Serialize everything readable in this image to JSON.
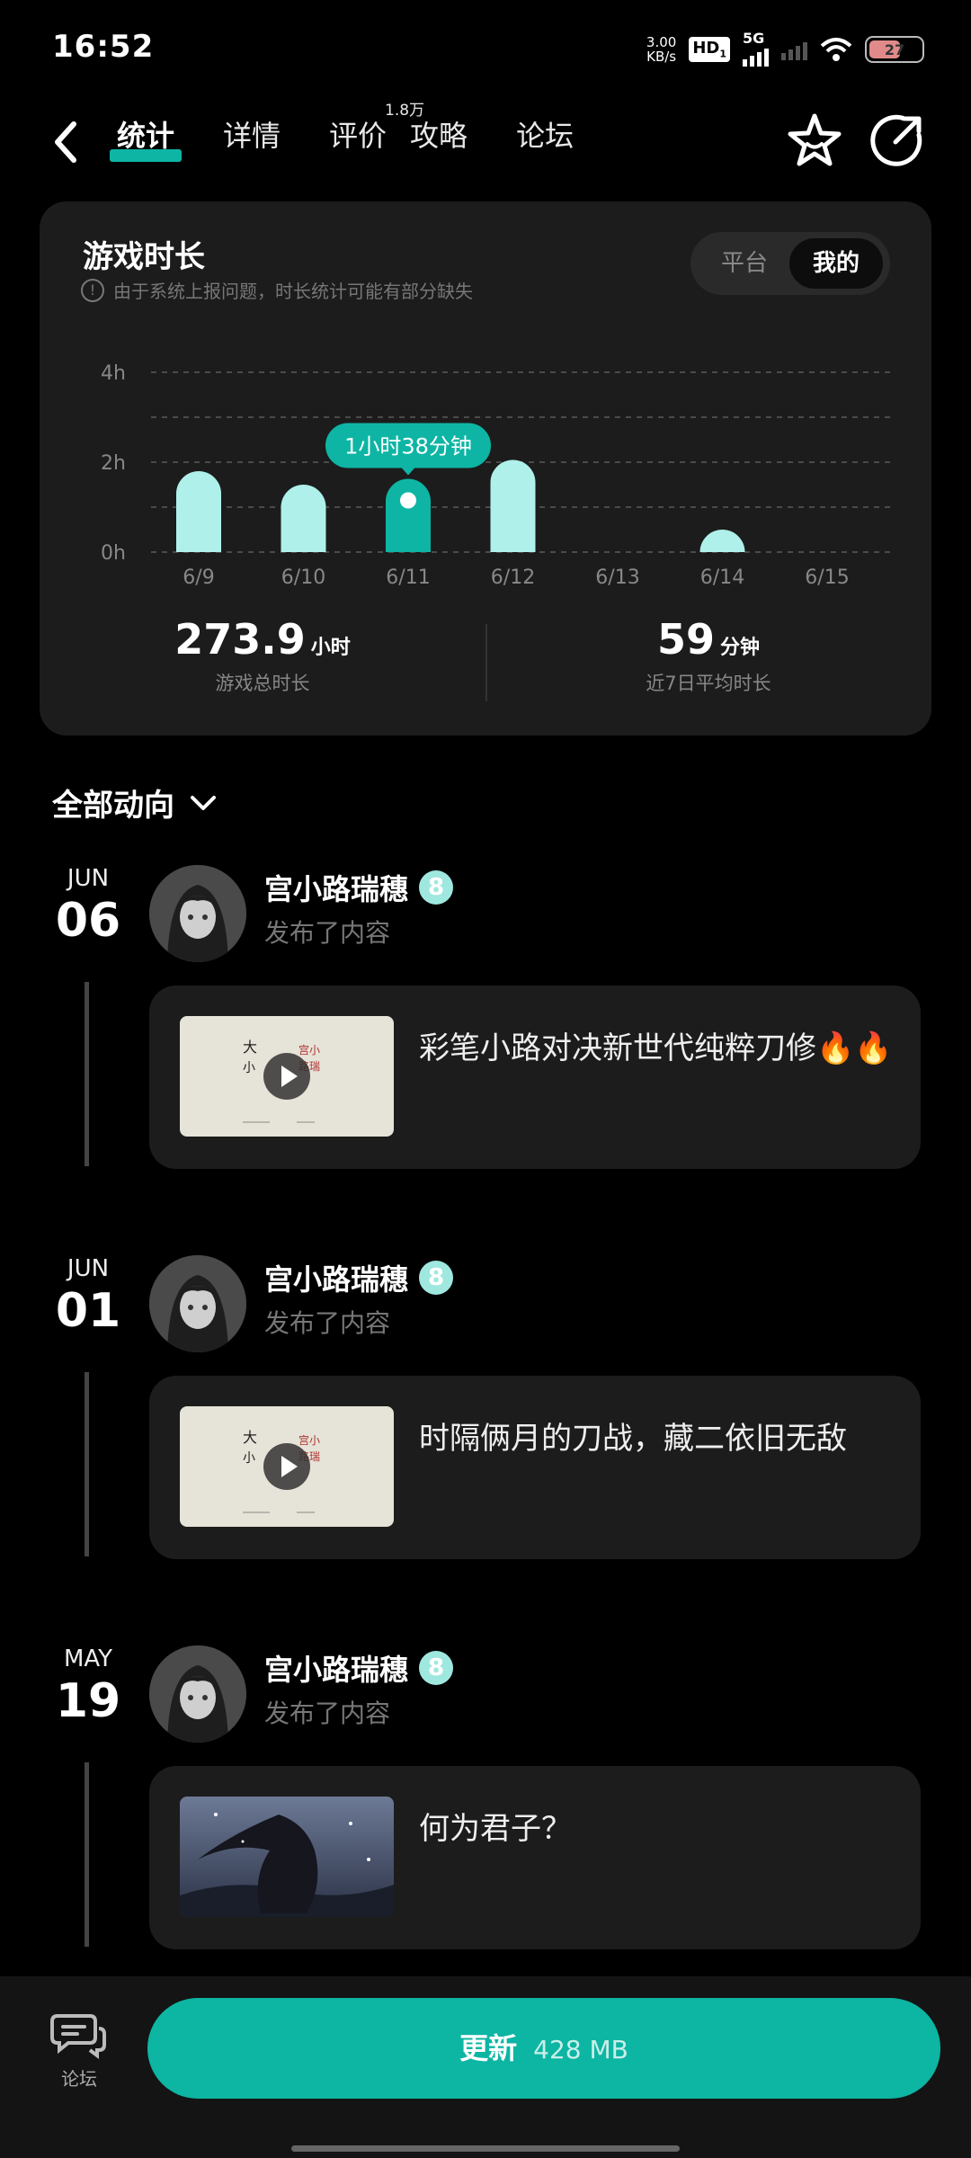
{
  "status_bar": {
    "time": "16:52",
    "net_speed": "3.00",
    "net_unit": "KB/s",
    "hd": "HD",
    "hd_sub": "1",
    "signal_type": "5G",
    "battery": "27"
  },
  "nav": {
    "tabs": [
      "统计",
      "详情",
      "评价",
      "攻略",
      "论坛"
    ],
    "review_count": "1.8万"
  },
  "stats_card": {
    "title": "游戏时长",
    "note": "由于系统上报问题，时长统计可能有部分缺失",
    "toggle": [
      "平台",
      "我的"
    ],
    "tooltip": "1小时38分钟",
    "total_value": "273.9",
    "total_unit": "小时",
    "total_label": "游戏总时长",
    "avg_value": "59",
    "avg_unit": "分钟",
    "avg_label": "近7日平均时长"
  },
  "chart_data": {
    "type": "bar",
    "categories": [
      "6/9",
      "6/10",
      "6/11",
      "6/12",
      "6/13",
      "6/14",
      "6/15"
    ],
    "values": [
      1.8,
      1.5,
      1.63,
      2.05,
      0,
      0.2,
      0
    ],
    "unit": "h",
    "yticks": [
      "4h",
      "2h",
      "0h"
    ],
    "ylim": [
      0,
      4
    ],
    "selected_index": 2,
    "colors": {
      "bar": "#aff0ea",
      "selected": "#0eb5a4"
    }
  },
  "filter": {
    "label": "全部动向"
  },
  "feed": [
    {
      "month": "JUN",
      "day": "06",
      "user": "宫小路瑞穗",
      "level": "8",
      "action": "发布了内容",
      "text": "彩笔小路对决新世代纯粹刀修🔥🔥",
      "video": true,
      "thumb": "calligraphy"
    },
    {
      "month": "JUN",
      "day": "01",
      "user": "宫小路瑞穗",
      "level": "8",
      "action": "发布了内容",
      "text": "时隔俩月的刀战，藏二依旧无敌",
      "video": true,
      "thumb": "calligraphy"
    },
    {
      "month": "MAY",
      "day": "19",
      "user": "宫小路瑞穗",
      "level": "8",
      "action": "发布了内容",
      "text": "何为君子？",
      "video": false,
      "thumb": "night"
    }
  ],
  "bottom": {
    "forum_label": "论坛",
    "update_label": "更新",
    "update_size": "428 MB"
  }
}
